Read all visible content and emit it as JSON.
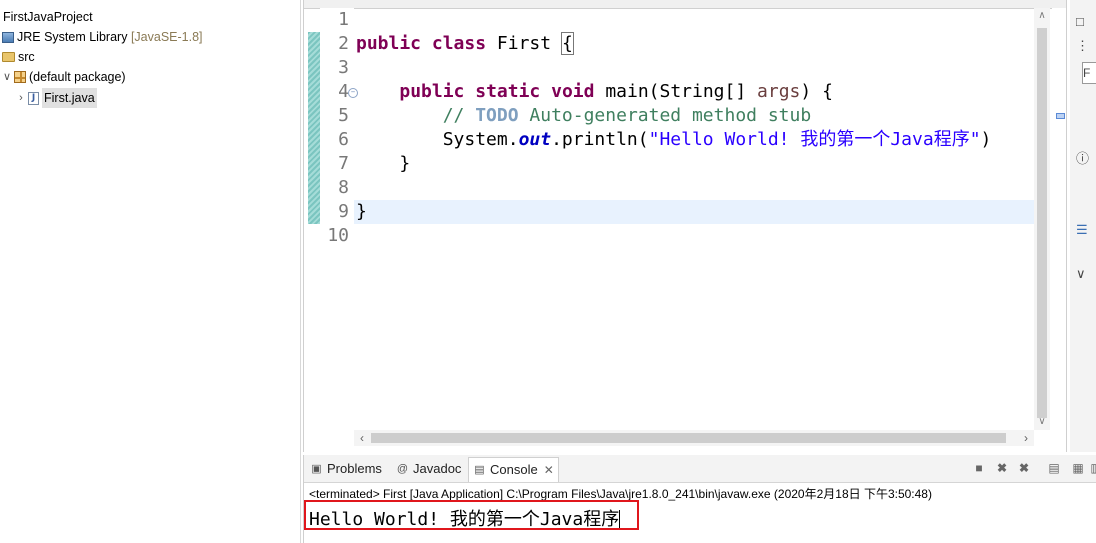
{
  "explorer": {
    "rows": [
      {
        "label": "FirstJavaProject"
      },
      {
        "label": "JRE System Library",
        "suffix": "[JavaSE-1.8]"
      },
      {
        "label": "src"
      },
      {
        "label": "(default package)",
        "expanded": true
      },
      {
        "label": "First.java",
        "selected": true
      }
    ]
  },
  "editor": {
    "line_numbers": [
      "1",
      "2",
      "3",
      "4",
      "5",
      "6",
      "7",
      "8",
      "9",
      "10"
    ],
    "code": {
      "l2": {
        "kw1": "public",
        "kw2": "class",
        "name": "First",
        "brace": "{"
      },
      "l4": {
        "kw1": "public",
        "kw2": "static",
        "kw3": "void",
        "sig": "main(String[]",
        "param": "args",
        "end": ") {"
      },
      "l5": {
        "comment_start": "// ",
        "todo": "TODO",
        "comment_rest": " Auto-generated method stub"
      },
      "l6": {
        "prefix": "System.",
        "field": "out",
        "call": ".println(",
        "string": "\"Hello World! 我的第一个Java程序\"",
        "end": ")"
      },
      "l7": {
        "brace": "}"
      },
      "l9": {
        "brace": "}"
      }
    }
  },
  "console": {
    "tabs": [
      {
        "label": "Problems",
        "icon": "problems-icon"
      },
      {
        "label": "Javadoc",
        "icon": "at-icon"
      },
      {
        "label": "Console",
        "icon": "console-icon",
        "active": true
      }
    ],
    "terminated_line": "<terminated> First [Java Application] C:\\Program Files\\Java\\jre1.8.0_241\\bin\\javaw.exe (2020年2月18日 下午3:50:48)",
    "output": "Hello World! 我的第一个Java程序"
  },
  "colors": {
    "keyword": "#7f0055",
    "comment": "#3f7f5f",
    "string": "#2a00ff",
    "highlight_box": "#e0161c",
    "current_line": "#e8f2fe"
  }
}
